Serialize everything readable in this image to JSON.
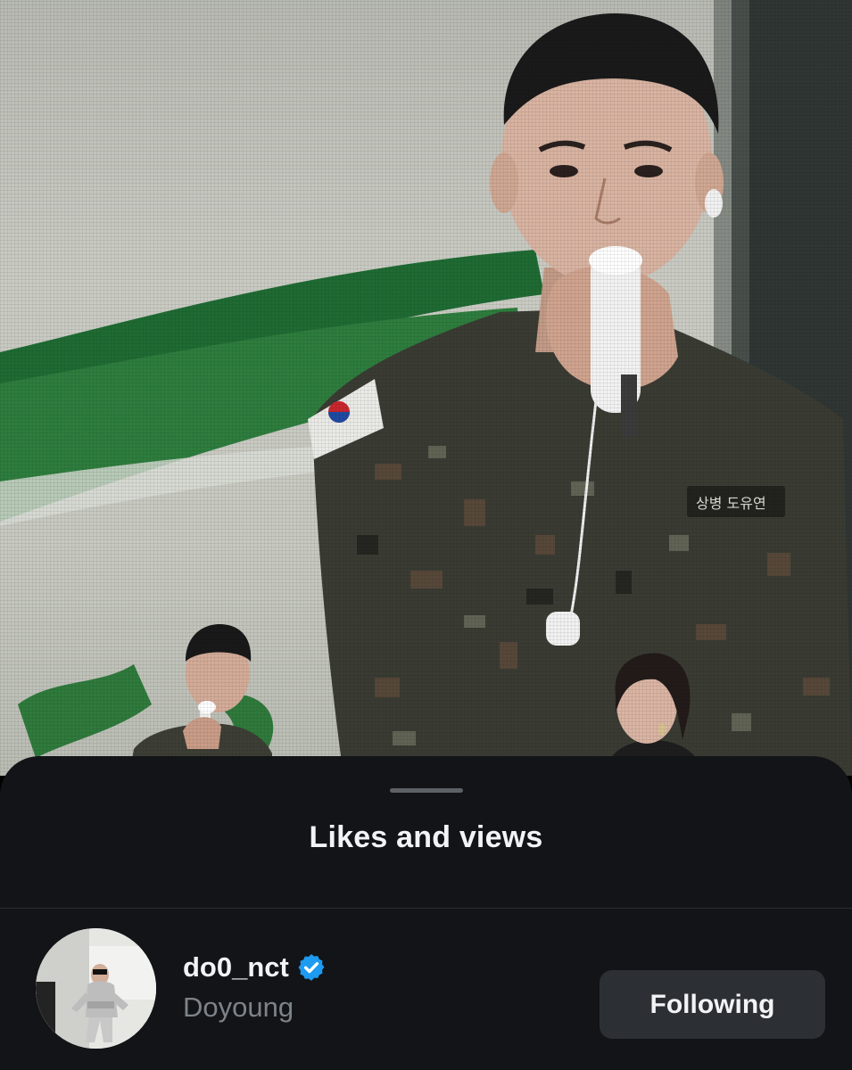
{
  "photo": {
    "description_icon": "photo-image"
  },
  "sheet": {
    "title": "Likes and views"
  },
  "user": {
    "username": "do0_nct",
    "display_name": "Doyoung",
    "verified": true,
    "follow_label": "Following"
  },
  "colors": {
    "sheet_bg": "#121417",
    "button_bg": "#2c2f34",
    "verified_blue": "#1d9bf0",
    "secondary_text": "#7d838a"
  }
}
